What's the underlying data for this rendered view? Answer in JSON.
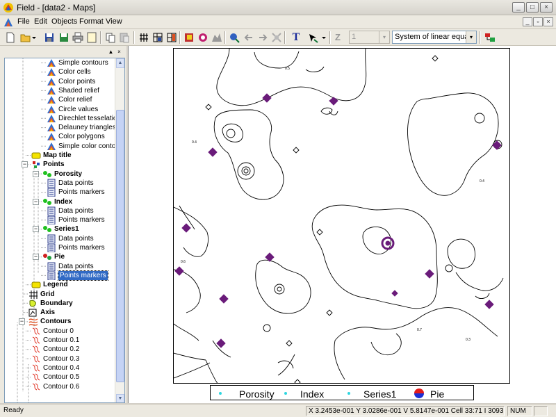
{
  "window": {
    "title": "Field - [data2 - Maps]",
    "controls": {
      "minimize": "_",
      "maximize": "□",
      "close": "×"
    }
  },
  "menu": {
    "items": [
      "File",
      "Edit",
      "Objects",
      "Format",
      "View"
    ],
    "mdi_controls": {
      "minimize": "_",
      "restore": "▫",
      "close": "×"
    }
  },
  "toolbar": {
    "text_tool": "T",
    "z_label": "Z",
    "z_value": "1",
    "solver_value": "System of linear equations",
    "combo_arrow": "▾"
  },
  "tree": {
    "panel_controls": {
      "pin": "▲",
      "close": "×"
    },
    "nodes": [
      {
        "label": "Simple contours",
        "icon": "contour-layer-icon",
        "depth": 4,
        "bold": false
      },
      {
        "label": "Color cells",
        "icon": "contour-layer-icon",
        "depth": 4,
        "bold": false
      },
      {
        "label": "Color points",
        "icon": "contour-layer-icon",
        "depth": 4,
        "bold": false
      },
      {
        "label": "Shaded relief",
        "icon": "contour-layer-icon",
        "depth": 4,
        "bold": false
      },
      {
        "label": "Color relief",
        "icon": "contour-layer-icon",
        "depth": 4,
        "bold": false
      },
      {
        "label": "Circle values",
        "icon": "contour-layer-icon",
        "depth": 4,
        "bold": false
      },
      {
        "label": "Direchlet tesselations",
        "icon": "contour-layer-icon",
        "depth": 4,
        "bold": false
      },
      {
        "label": "Delauney triangles",
        "icon": "contour-layer-icon",
        "depth": 4,
        "bold": false
      },
      {
        "label": "Color polygons",
        "icon": "contour-layer-icon",
        "depth": 4,
        "bold": false
      },
      {
        "label": "Simple color contours",
        "icon": "contour-layer-icon",
        "depth": 4,
        "bold": false
      },
      {
        "label": "Map title",
        "icon": "map-title-icon",
        "depth": 2,
        "bold": true
      },
      {
        "label": "Points",
        "icon": "points-icon",
        "depth": 2,
        "bold": true,
        "expander": "−"
      },
      {
        "label": "Porosity",
        "icon": "green-points-icon",
        "depth": 3,
        "bold": true,
        "expander": "−"
      },
      {
        "label": "Data points",
        "icon": "data-sheet-icon",
        "depth": 4,
        "bold": false
      },
      {
        "label": "Points markers",
        "icon": "data-sheet-icon",
        "depth": 4,
        "bold": false
      },
      {
        "label": "Index",
        "icon": "green-points-icon",
        "depth": 3,
        "bold": true,
        "expander": "−"
      },
      {
        "label": "Data points",
        "icon": "data-sheet-icon",
        "depth": 4,
        "bold": false
      },
      {
        "label": "Points markers",
        "icon": "data-sheet-icon",
        "depth": 4,
        "bold": false
      },
      {
        "label": "Series1",
        "icon": "green-points-icon",
        "depth": 3,
        "bold": true,
        "expander": "−"
      },
      {
        "label": "Data points",
        "icon": "data-sheet-icon",
        "depth": 4,
        "bold": false
      },
      {
        "label": "Points markers",
        "icon": "data-sheet-icon",
        "depth": 4,
        "bold": false
      },
      {
        "label": "Pie",
        "icon": "pie-points-icon",
        "depth": 3,
        "bold": true,
        "expander": "−"
      },
      {
        "label": "Data points",
        "icon": "data-sheet-icon",
        "depth": 4,
        "bold": false
      },
      {
        "label": "Points markers",
        "icon": "data-sheet-icon",
        "depth": 4,
        "bold": false,
        "selected": true
      },
      {
        "label": "Legend",
        "icon": "legend-icon",
        "depth": 2,
        "bold": true
      },
      {
        "label": "Grid",
        "icon": "grid-icon",
        "depth": 1,
        "bold": true
      },
      {
        "label": "Boundary",
        "icon": "boundary-icon",
        "depth": 1,
        "bold": true
      },
      {
        "label": "Axis",
        "icon": "axis-icon",
        "depth": 1,
        "bold": true
      },
      {
        "label": "Contours",
        "icon": "contours-icon",
        "depth": 1,
        "bold": true,
        "expander": "−"
      },
      {
        "label": "Contour 0",
        "icon": "contour-line-icon",
        "depth": 2,
        "bold": false
      },
      {
        "label": "Contour 0.1",
        "icon": "contour-line-icon",
        "depth": 2,
        "bold": false
      },
      {
        "label": "Contour 0.2",
        "icon": "contour-line-icon",
        "depth": 2,
        "bold": false
      },
      {
        "label": "Contour 0.3",
        "icon": "contour-line-icon",
        "depth": 2,
        "bold": false
      },
      {
        "label": "Contour 0.4",
        "icon": "contour-line-icon",
        "depth": 2,
        "bold": false
      },
      {
        "label": "Contour 0.5",
        "icon": "contour-line-icon",
        "depth": 2,
        "bold": false
      },
      {
        "label": "Contour 0.6",
        "icon": "contour-line-icon",
        "depth": 2,
        "bold": false
      }
    ]
  },
  "map": {
    "contour_labels": [
      "0.3",
      "0.4",
      "0.5",
      "0.6",
      "0.7"
    ],
    "legend": [
      {
        "label": "Porosity",
        "marker": "cyan-dot"
      },
      {
        "label": "Index",
        "marker": "cyan-dot"
      },
      {
        "label": "Series1",
        "marker": "cyan-dot"
      },
      {
        "label": "Pie",
        "marker": "pie-circle"
      }
    ],
    "colors": {
      "marker": "#6a1b7a",
      "legend_dot": "#2dd6e0",
      "pie_top": "#e41b1b",
      "pie_bottom": "#1b2fd6"
    }
  },
  "status": {
    "ready": "Ready",
    "coords": "X 3.2453e-001 Y 3.0286e-001 V 5.8147e-001 Cell 33:71 I 3093",
    "num": "NUM"
  }
}
